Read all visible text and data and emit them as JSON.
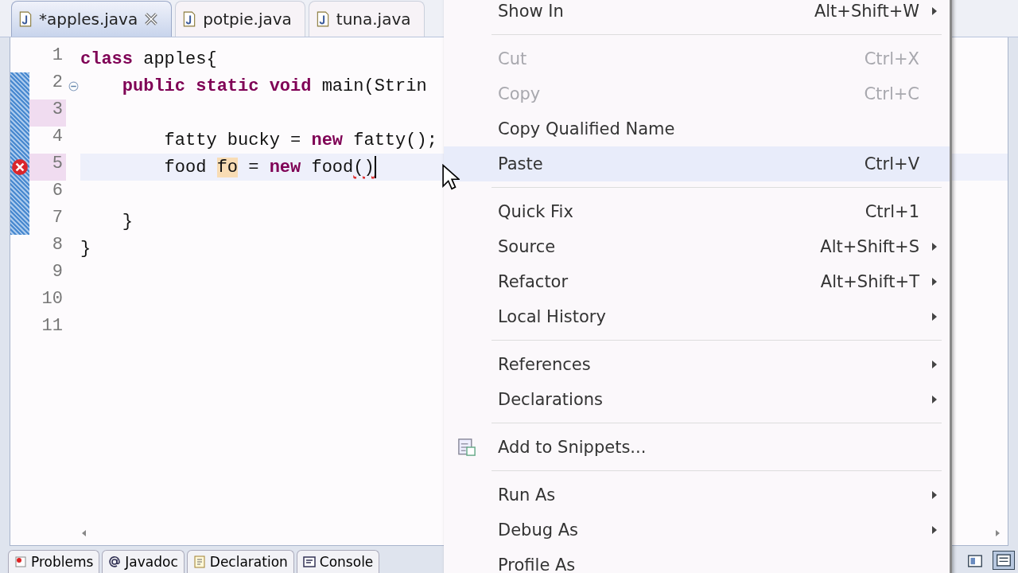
{
  "editor_tabs": [
    {
      "label": "*apples.java",
      "selected": true
    },
    {
      "label": "potpie.java",
      "selected": false
    },
    {
      "label": "tuna.java",
      "selected": false
    }
  ],
  "code_lines": [
    {
      "number": "1",
      "changed": false,
      "modified": false,
      "current": false,
      "error": false,
      "foldable": false,
      "tokens": [
        {
          "kind": "keyword",
          "text": "class"
        },
        {
          "kind": "plain",
          "text": " apples{"
        }
      ]
    },
    {
      "number": "2",
      "changed": false,
      "modified": true,
      "current": false,
      "error": false,
      "foldable": true,
      "tokens": [
        {
          "kind": "keyword",
          "text": "    public static void"
        },
        {
          "kind": "plain",
          "text": " main(Strin"
        }
      ]
    },
    {
      "number": "3",
      "changed": true,
      "modified": true,
      "current": false,
      "error": false,
      "foldable": false
    },
    {
      "number": "4",
      "changed": false,
      "modified": true,
      "current": false,
      "error": false,
      "foldable": false,
      "tokens": [
        {
          "kind": "plain",
          "text": "        fatty bucky = "
        },
        {
          "kind": "keyword",
          "text": "new"
        },
        {
          "kind": "plain",
          "text": " fatty();"
        }
      ]
    },
    {
      "number": "5",
      "changed": true,
      "modified": true,
      "current": true,
      "error": true,
      "foldable": false,
      "tokens": [
        {
          "kind": "plain",
          "text": "        food "
        },
        {
          "kind": "occurrence",
          "text": "fo"
        },
        {
          "kind": "plain",
          "text": " = "
        },
        {
          "kind": "keyword",
          "text": "new"
        },
        {
          "kind": "plain",
          "text": " food"
        },
        {
          "kind": "error",
          "text": "()"
        }
      ]
    },
    {
      "number": "6",
      "changed": false,
      "modified": true,
      "current": false,
      "error": false,
      "foldable": false
    },
    {
      "number": "7",
      "changed": false,
      "modified": true,
      "current": false,
      "error": false,
      "foldable": false,
      "tokens": [
        {
          "kind": "plain",
          "text": "    }"
        }
      ]
    },
    {
      "number": "8",
      "changed": false,
      "modified": false,
      "current": false,
      "error": false,
      "foldable": false,
      "tokens": [
        {
          "kind": "plain",
          "text": "}"
        }
      ]
    },
    {
      "number": "9",
      "changed": false,
      "modified": false,
      "current": false,
      "error": false,
      "foldable": false
    },
    {
      "number": "10",
      "changed": false,
      "modified": false,
      "current": false,
      "error": false,
      "foldable": false
    },
    {
      "number": "11",
      "changed": false,
      "modified": false,
      "current": false,
      "error": false,
      "foldable": false
    }
  ],
  "context_menu": [
    {
      "kind": "item",
      "label": "Show In",
      "shortcut": "Alt+Shift+W",
      "submenu": true,
      "disabled": false,
      "selected": false
    },
    {
      "kind": "separator"
    },
    {
      "kind": "item",
      "label": "Cut",
      "shortcut": "Ctrl+X",
      "submenu": false,
      "disabled": true,
      "selected": false
    },
    {
      "kind": "item",
      "label": "Copy",
      "shortcut": "Ctrl+C",
      "submenu": false,
      "disabled": true,
      "selected": false
    },
    {
      "kind": "item",
      "label": "Copy Qualified Name",
      "submenu": false,
      "disabled": false,
      "selected": false
    },
    {
      "kind": "item",
      "label": "Paste",
      "shortcut": "Ctrl+V",
      "submenu": false,
      "disabled": false,
      "selected": true
    },
    {
      "kind": "separator"
    },
    {
      "kind": "item",
      "label": "Quick Fix",
      "shortcut": "Ctrl+1",
      "submenu": false,
      "disabled": false,
      "selected": false
    },
    {
      "kind": "item",
      "label": "Source",
      "shortcut": "Alt+Shift+S",
      "submenu": true,
      "disabled": false,
      "selected": false
    },
    {
      "kind": "item",
      "label": "Refactor",
      "shortcut": "Alt+Shift+T",
      "submenu": true,
      "disabled": false,
      "selected": false
    },
    {
      "kind": "item",
      "label": "Local History",
      "submenu": true,
      "disabled": false,
      "selected": false
    },
    {
      "kind": "separator"
    },
    {
      "kind": "item",
      "label": "References",
      "submenu": true,
      "disabled": false,
      "selected": false
    },
    {
      "kind": "item",
      "label": "Declarations",
      "submenu": true,
      "disabled": false,
      "selected": false
    },
    {
      "kind": "separator"
    },
    {
      "kind": "item_with_icon",
      "label": "Add to Snippets...",
      "submenu": false,
      "disabled": false,
      "selected": false
    },
    {
      "kind": "separator"
    },
    {
      "kind": "item",
      "label": "Run As",
      "submenu": true,
      "disabled": false,
      "selected": false
    },
    {
      "kind": "item",
      "label": "Debug As",
      "submenu": true,
      "disabled": false,
      "selected": false
    },
    {
      "kind": "item",
      "label": "Profile As",
      "submenu": false,
      "disabled": false,
      "selected": false
    }
  ],
  "bottom_tabs": [
    {
      "label": "Problems"
    },
    {
      "label": "Javadoc"
    },
    {
      "label": "Declaration"
    },
    {
      "label": "Console"
    }
  ]
}
